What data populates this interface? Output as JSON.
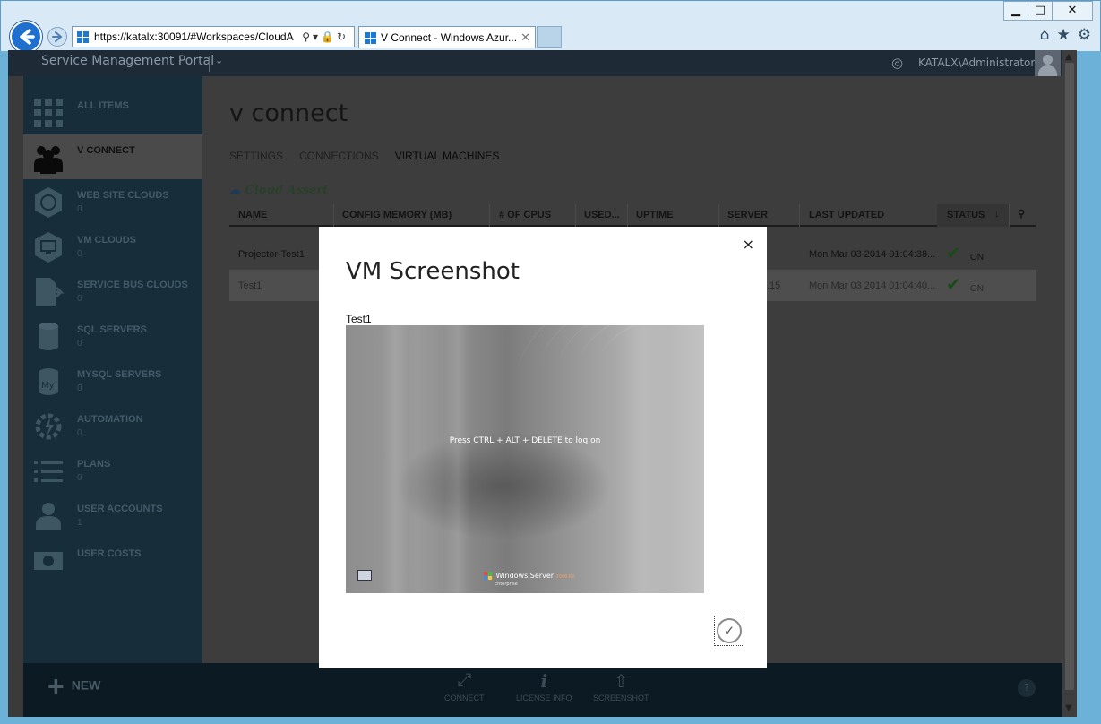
{
  "browser": {
    "url": "https://katalx:30091/#Workspaces/CloudA",
    "url_host": "katalx",
    "tab_title": "V Connect - Windows Azur...",
    "tab_close": "✕",
    "window_controls": {
      "minimize": "▁",
      "maximize": "□",
      "close": "✕"
    },
    "address_tools": "⚲▾🔒↻",
    "right_icons": {
      "home": "⌂",
      "favorites": "★",
      "settings": "⚙"
    }
  },
  "portal": {
    "brand": "Service Management Portal",
    "user": "KATALX\\Administrator"
  },
  "sidebar": {
    "items": [
      {
        "label": "ALL ITEMS",
        "count": "",
        "icon": "grid-icon"
      },
      {
        "label": "V CONNECT",
        "count": "",
        "icon": "people-icon"
      },
      {
        "label": "WEB SITE CLOUDS",
        "count": "0",
        "icon": "web-icon"
      },
      {
        "label": "VM CLOUDS",
        "count": "0",
        "icon": "monitor-icon"
      },
      {
        "label": "SERVICE BUS CLOUDS",
        "count": "0",
        "icon": "bus-icon"
      },
      {
        "label": "SQL SERVERS",
        "count": "0",
        "icon": "database-icon"
      },
      {
        "label": "MYSQL SERVERS",
        "count": "0",
        "icon": "mysql-icon"
      },
      {
        "label": "AUTOMATION",
        "count": "0",
        "icon": "gear-bolt-icon"
      },
      {
        "label": "PLANS",
        "count": "0",
        "icon": "list-icon"
      },
      {
        "label": "USER ACCOUNTS",
        "count": "1",
        "icon": "person-icon"
      },
      {
        "label": "USER COSTS",
        "count": "",
        "icon": "money-icon"
      }
    ]
  },
  "main": {
    "title": "v connect",
    "tabs": [
      "SETTINGS",
      "CONNECTIONS",
      "VIRTUAL MACHINES"
    ],
    "logo_text": "Cloud Assert",
    "columns": [
      "NAME",
      "CONFIG MEMORY (MB)",
      "# OF CPUS",
      "USED...",
      "UPTIME",
      "SERVER",
      "LAST UPDATED",
      "STATUS"
    ],
    "rows": [
      {
        "name": "Projector-Test1",
        "server": "",
        "last_updated": "Mon Mar 03 2014 01:04:38...",
        "status": "ON"
      },
      {
        "name": "Test1",
        "server": ".15",
        "last_updated": "Mon Mar 03 2014 01:04:40...",
        "status": "ON"
      }
    ]
  },
  "bottombar": {
    "new_label": "NEW",
    "actions": [
      "CONNECT",
      "LICENSE INFO",
      "SCREENSHOT"
    ],
    "help": "?"
  },
  "modal": {
    "title": "VM Screenshot",
    "close": "×",
    "vm_name": "Test1",
    "screen_message": "Press CTRL + ALT + DELETE to log on",
    "screen_brand": "Windows Server",
    "screen_version": "2008 R2",
    "screen_edition": "Enterprise",
    "ok": "✓"
  }
}
